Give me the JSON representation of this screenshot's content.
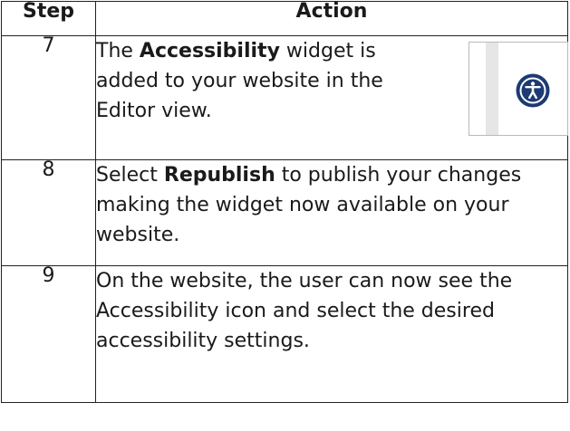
{
  "table": {
    "headers": {
      "step": "Step",
      "action": "Action"
    },
    "rows": [
      {
        "step": "7",
        "action_parts": [
          "The ",
          "Accessibility",
          " widget is added to your website in the Editor view."
        ]
      },
      {
        "step": "8",
        "action_parts": [
          "Select ",
          "Republish",
          " to publish your changes making the widget now available on your website."
        ]
      },
      {
        "step": "9",
        "action_parts": [
          "On the website, the user can now see the Accessibility icon and select the desired accessibility settings."
        ]
      }
    ]
  },
  "icons": {
    "accessibility": "accessibility-icon"
  },
  "colors": {
    "icon_fill": "#1d3a73",
    "border": "#222222"
  }
}
